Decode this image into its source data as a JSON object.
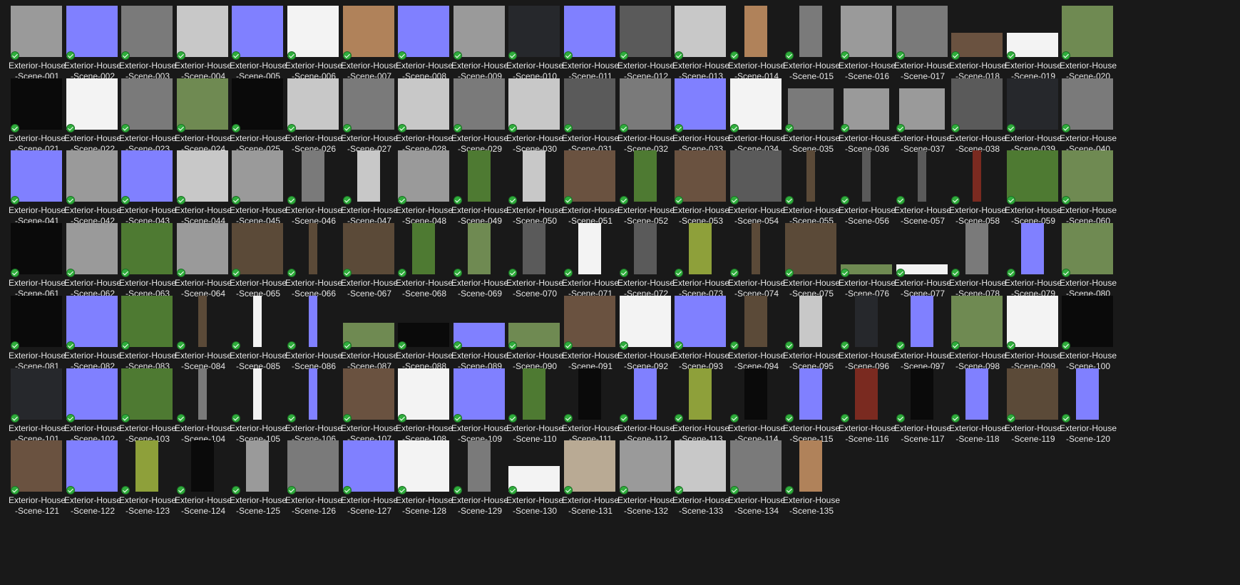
{
  "explorer": {
    "view": "Large icons",
    "status_icon": "synced-check-icon",
    "status_color": "#2fae3c",
    "items": [
      {
        "name": "Exterior-House-Scene-001",
        "tex": "g3"
      },
      {
        "name": "Exterior-House-Scene-002",
        "tex": "n"
      },
      {
        "name": "Exterior-House-Scene-003",
        "tex": "g2"
      },
      {
        "name": "Exterior-House-Scene-004",
        "tex": "g4"
      },
      {
        "name": "Exterior-House-Scene-005",
        "tex": "n"
      },
      {
        "name": "Exterior-House-Scene-006",
        "tex": "w"
      },
      {
        "name": "Exterior-House-Scene-007",
        "tex": "wood"
      },
      {
        "name": "Exterior-House-Scene-008",
        "tex": "n"
      },
      {
        "name": "Exterior-House-Scene-009",
        "tex": "g3"
      },
      {
        "name": "Exterior-House-Scene-010",
        "tex": "dk"
      },
      {
        "name": "Exterior-House-Scene-011",
        "tex": "n"
      },
      {
        "name": "Exterior-House-Scene-012",
        "tex": "g1"
      },
      {
        "name": "Exterior-House-Scene-013",
        "tex": "g4"
      },
      {
        "name": "Exterior-House-Scene-014",
        "tex": "wood",
        "shape": "tall"
      },
      {
        "name": "Exterior-House-Scene-015",
        "tex": "g2",
        "shape": "tall"
      },
      {
        "name": "Exterior-House-Scene-016",
        "tex": "g3"
      },
      {
        "name": "Exterior-House-Scene-017",
        "tex": "g2"
      },
      {
        "name": "Exterior-House-Scene-018",
        "tex": "brn",
        "shape": "wide"
      },
      {
        "name": "Exterior-House-Scene-019",
        "tex": "w",
        "shape": "wide"
      },
      {
        "name": "Exterior-House-Scene-020",
        "tex": "moss"
      },
      {
        "name": "Exterior-House-Scene-021",
        "tex": "blk"
      },
      {
        "name": "Exterior-House-Scene-022",
        "tex": "w"
      },
      {
        "name": "Exterior-House-Scene-023",
        "tex": "g2"
      },
      {
        "name": "Exterior-House-Scene-024",
        "tex": "moss"
      },
      {
        "name": "Exterior-House-Scene-025",
        "tex": "blk"
      },
      {
        "name": "Exterior-House-Scene-026",
        "tex": "g4"
      },
      {
        "name": "Exterior-House-Scene-027",
        "tex": "g2"
      },
      {
        "name": "Exterior-House-Scene-028",
        "tex": "g4"
      },
      {
        "name": "Exterior-House-Scene-029",
        "tex": "g2"
      },
      {
        "name": "Exterior-House-Scene-030",
        "tex": "g4"
      },
      {
        "name": "Exterior-House-Scene-031",
        "tex": "g1"
      },
      {
        "name": "Exterior-House-Scene-032",
        "tex": "g2"
      },
      {
        "name": "Exterior-House-Scene-033",
        "tex": "n"
      },
      {
        "name": "Exterior-House-Scene-034",
        "tex": "w"
      },
      {
        "name": "Exterior-House-Scene-035",
        "tex": "g2",
        "shape": "mid"
      },
      {
        "name": "Exterior-House-Scene-036",
        "tex": "g3",
        "shape": "mid"
      },
      {
        "name": "Exterior-House-Scene-037",
        "tex": "g3",
        "shape": "mid"
      },
      {
        "name": "Exterior-House-Scene-038",
        "tex": "g1"
      },
      {
        "name": "Exterior-House-Scene-039",
        "tex": "dk"
      },
      {
        "name": "Exterior-House-Scene-040",
        "tex": "g2"
      },
      {
        "name": "Exterior-House-Scene-041",
        "tex": "n"
      },
      {
        "name": "Exterior-House-Scene-042",
        "tex": "g3"
      },
      {
        "name": "Exterior-House-Scene-043",
        "tex": "n"
      },
      {
        "name": "Exterior-House-Scene-044",
        "tex": "g4"
      },
      {
        "name": "Exterior-House-Scene-045",
        "tex": "g3"
      },
      {
        "name": "Exterior-House-Scene-046",
        "tex": "g2",
        "shape": "tall"
      },
      {
        "name": "Exterior-House-Scene-047",
        "tex": "g4",
        "shape": "tall"
      },
      {
        "name": "Exterior-House-Scene-048",
        "tex": "g3"
      },
      {
        "name": "Exterior-House-Scene-049",
        "tex": "leaf",
        "shape": "tall"
      },
      {
        "name": "Exterior-House-Scene-050",
        "tex": "g4",
        "shape": "tall"
      },
      {
        "name": "Exterior-House-Scene-051",
        "tex": "brn"
      },
      {
        "name": "Exterior-House-Scene-052",
        "tex": "leaf",
        "shape": "tall"
      },
      {
        "name": "Exterior-House-Scene-053",
        "tex": "brn"
      },
      {
        "name": "Exterior-House-Scene-054",
        "tex": "g1"
      },
      {
        "name": "Exterior-House-Scene-055",
        "tex": "bark",
        "shape": "thin"
      },
      {
        "name": "Exterior-House-Scene-056",
        "tex": "g1",
        "shape": "thin"
      },
      {
        "name": "Exterior-House-Scene-057",
        "tex": "g1",
        "shape": "thin"
      },
      {
        "name": "Exterior-House-Scene-058",
        "tex": "red",
        "shape": "thin"
      },
      {
        "name": "Exterior-House-Scene-059",
        "tex": "leaf"
      },
      {
        "name": "Exterior-House-Scene-060",
        "tex": "moss"
      },
      {
        "name": "Exterior-House-Scene-061",
        "tex": "blk"
      },
      {
        "name": "Exterior-House-Scene-062",
        "tex": "g3"
      },
      {
        "name": "Exterior-House-Scene-063",
        "tex": "leaf"
      },
      {
        "name": "Exterior-House-Scene-064",
        "tex": "g3"
      },
      {
        "name": "Exterior-House-Scene-065",
        "tex": "bark"
      },
      {
        "name": "Exterior-House-Scene-066",
        "tex": "bark",
        "shape": "thin"
      },
      {
        "name": "Exterior-House-Scene-067",
        "tex": "bark"
      },
      {
        "name": "Exterior-House-Scene-068",
        "tex": "leaf",
        "shape": "tall"
      },
      {
        "name": "Exterior-House-Scene-069",
        "tex": "moss",
        "shape": "tall"
      },
      {
        "name": "Exterior-House-Scene-070",
        "tex": "g1",
        "shape": "tall"
      },
      {
        "name": "Exterior-House-Scene-071",
        "tex": "w",
        "shape": "tall"
      },
      {
        "name": "Exterior-House-Scene-072",
        "tex": "g1",
        "shape": "tall"
      },
      {
        "name": "Exterior-House-Scene-073",
        "tex": "yg",
        "shape": "tall"
      },
      {
        "name": "Exterior-House-Scene-074",
        "tex": "bark",
        "shape": "thin"
      },
      {
        "name": "Exterior-House-Scene-075",
        "tex": "bark"
      },
      {
        "name": "Exterior-House-Scene-076",
        "tex": "moss",
        "shape": "strip"
      },
      {
        "name": "Exterior-House-Scene-077",
        "tex": "w",
        "shape": "strip"
      },
      {
        "name": "Exterior-House-Scene-078",
        "tex": "g2",
        "shape": "tall"
      },
      {
        "name": "Exterior-House-Scene-079",
        "tex": "n",
        "shape": "tall"
      },
      {
        "name": "Exterior-House-Scene-080",
        "tex": "moss"
      },
      {
        "name": "Exterior-House-Scene-081",
        "tex": "blk"
      },
      {
        "name": "Exterior-House-Scene-082",
        "tex": "n"
      },
      {
        "name": "Exterior-House-Scene-083",
        "tex": "leaf"
      },
      {
        "name": "Exterior-House-Scene-084",
        "tex": "bark",
        "shape": "thin"
      },
      {
        "name": "Exterior-House-Scene-085",
        "tex": "w",
        "shape": "thin"
      },
      {
        "name": "Exterior-House-Scene-086",
        "tex": "n",
        "shape": "thin"
      },
      {
        "name": "Exterior-House-Scene-087",
        "tex": "moss",
        "shape": "wide"
      },
      {
        "name": "Exterior-House-Scene-088",
        "tex": "blk",
        "shape": "wide"
      },
      {
        "name": "Exterior-House-Scene-089",
        "tex": "n",
        "shape": "wide"
      },
      {
        "name": "Exterior-House-Scene-090",
        "tex": "moss",
        "shape": "wide"
      },
      {
        "name": "Exterior-House-Scene-091",
        "tex": "brn"
      },
      {
        "name": "Exterior-House-Scene-092",
        "tex": "w"
      },
      {
        "name": "Exterior-House-Scene-093",
        "tex": "n"
      },
      {
        "name": "Exterior-House-Scene-094",
        "tex": "bark",
        "shape": "tall"
      },
      {
        "name": "Exterior-House-Scene-095",
        "tex": "g4",
        "shape": "tall"
      },
      {
        "name": "Exterior-House-Scene-096",
        "tex": "dk",
        "shape": "tall"
      },
      {
        "name": "Exterior-House-Scene-097",
        "tex": "n",
        "shape": "tall"
      },
      {
        "name": "Exterior-House-Scene-098",
        "tex": "moss"
      },
      {
        "name": "Exterior-House-Scene-099",
        "tex": "w"
      },
      {
        "name": "Exterior-House-Scene-100",
        "tex": "blk"
      },
      {
        "name": "Exterior-House-Scene-101",
        "tex": "dk"
      },
      {
        "name": "Exterior-House-Scene-102",
        "tex": "n"
      },
      {
        "name": "Exterior-House-Scene-103",
        "tex": "leaf"
      },
      {
        "name": "Exterior-House-Scene-104",
        "tex": "g2",
        "shape": "thin"
      },
      {
        "name": "Exterior-House-Scene-105",
        "tex": "w",
        "shape": "thin"
      },
      {
        "name": "Exterior-House-Scene-106",
        "tex": "n",
        "shape": "thin"
      },
      {
        "name": "Exterior-House-Scene-107",
        "tex": "brn"
      },
      {
        "name": "Exterior-House-Scene-108",
        "tex": "w"
      },
      {
        "name": "Exterior-House-Scene-109",
        "tex": "n"
      },
      {
        "name": "Exterior-House-Scene-110",
        "tex": "leaf",
        "shape": "tall"
      },
      {
        "name": "Exterior-House-Scene-111",
        "tex": "blk",
        "shape": "tall"
      },
      {
        "name": "Exterior-House-Scene-112",
        "tex": "n",
        "shape": "tall"
      },
      {
        "name": "Exterior-House-Scene-113",
        "tex": "yg",
        "shape": "tall"
      },
      {
        "name": "Exterior-House-Scene-114",
        "tex": "blk",
        "shape": "tall"
      },
      {
        "name": "Exterior-House-Scene-115",
        "tex": "n",
        "shape": "tall"
      },
      {
        "name": "Exterior-House-Scene-116",
        "tex": "red",
        "shape": "tall"
      },
      {
        "name": "Exterior-House-Scene-117",
        "tex": "blk",
        "shape": "tall"
      },
      {
        "name": "Exterior-House-Scene-118",
        "tex": "n",
        "shape": "tall"
      },
      {
        "name": "Exterior-House-Scene-119",
        "tex": "bark"
      },
      {
        "name": "Exterior-House-Scene-120",
        "tex": "n",
        "shape": "tall"
      },
      {
        "name": "Exterior-House-Scene-121",
        "tex": "brn"
      },
      {
        "name": "Exterior-House-Scene-122",
        "tex": "n"
      },
      {
        "name": "Exterior-House-Scene-123",
        "tex": "yg",
        "shape": "tall"
      },
      {
        "name": "Exterior-House-Scene-124",
        "tex": "blk",
        "shape": "tall"
      },
      {
        "name": "Exterior-House-Scene-125",
        "tex": "g3",
        "shape": "tall"
      },
      {
        "name": "Exterior-House-Scene-126",
        "tex": "g2"
      },
      {
        "name": "Exterior-House-Scene-127",
        "tex": "n"
      },
      {
        "name": "Exterior-House-Scene-128",
        "tex": "w"
      },
      {
        "name": "Exterior-House-Scene-129",
        "tex": "g2",
        "shape": "tall"
      },
      {
        "name": "Exterior-House-Scene-130",
        "tex": "w",
        "shape": "strip2"
      },
      {
        "name": "Exterior-House-Scene-131",
        "tex": "tan"
      },
      {
        "name": "Exterior-House-Scene-132",
        "tex": "g3"
      },
      {
        "name": "Exterior-House-Scene-133",
        "tex": "g4"
      },
      {
        "name": "Exterior-House-Scene-134",
        "tex": "g2"
      },
      {
        "name": "Exterior-House-Scene-135",
        "tex": "wood",
        "shape": "tall"
      }
    ],
    "texture_colors": {
      "g1": "#5a5a5a",
      "g2": "#7a7a7a",
      "g3": "#9a9a9a",
      "g4": "#c8c8c8",
      "w": "#f3f3f3",
      "n": "#8080ff",
      "wood": "#b0825a",
      "dk": "#26282c",
      "brn": "#6a5240",
      "blk": "#0a0a0a",
      "moss": "#6f8a52",
      "leaf": "#4e7a32",
      "yg": "#8ea03a",
      "bark": "#5b4a38",
      "red": "#7a2a20",
      "tan": "#b9aa94"
    }
  }
}
